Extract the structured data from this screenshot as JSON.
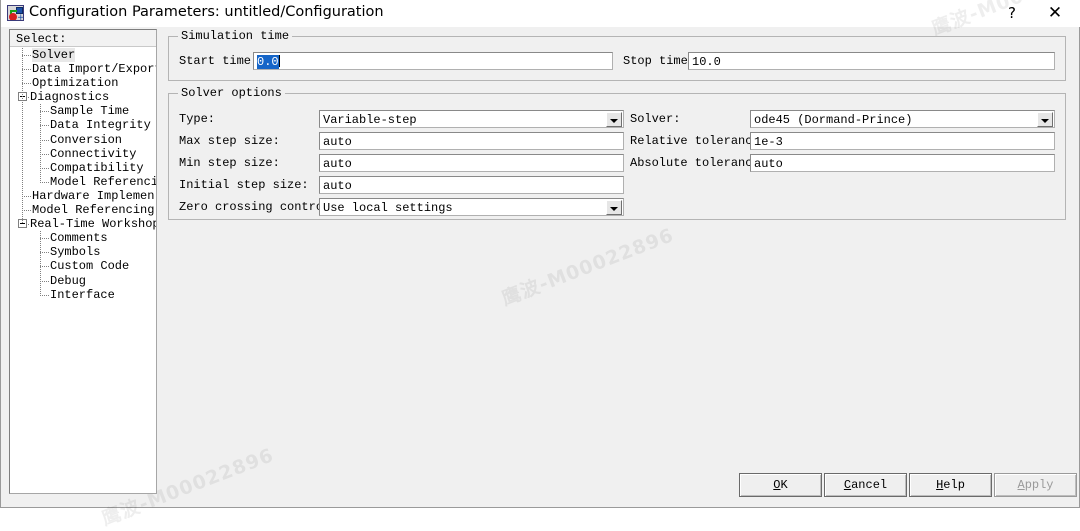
{
  "window": {
    "title": "Configuration Parameters: untitled/Configuration",
    "icon": "simulink-icon",
    "help_button": "?",
    "close_button": "✕"
  },
  "tree": {
    "header": "Select:",
    "nodes": [
      {
        "label": "Solver",
        "depth": 1,
        "selected": true,
        "expander": false
      },
      {
        "label": "Data Import/Export",
        "depth": 1,
        "selected": false,
        "expander": false
      },
      {
        "label": "Optimization",
        "depth": 1,
        "selected": false,
        "expander": false
      },
      {
        "label": "Diagnostics",
        "depth": 0,
        "selected": false,
        "expander": true
      },
      {
        "label": "Sample Time",
        "depth": 2,
        "selected": false,
        "expander": false
      },
      {
        "label": "Data Integrity",
        "depth": 2,
        "selected": false,
        "expander": false
      },
      {
        "label": "Conversion",
        "depth": 2,
        "selected": false,
        "expander": false
      },
      {
        "label": "Connectivity",
        "depth": 2,
        "selected": false,
        "expander": false
      },
      {
        "label": "Compatibility",
        "depth": 2,
        "selected": false,
        "expander": false
      },
      {
        "label": "Model Referencing",
        "depth": 2,
        "selected": false,
        "expander": false
      },
      {
        "label": "Hardware Implemen...",
        "depth": 1,
        "selected": false,
        "expander": false
      },
      {
        "label": "Model Referencing",
        "depth": 1,
        "selected": false,
        "expander": false
      },
      {
        "label": "Real-Time Workshop",
        "depth": 0,
        "selected": false,
        "expander": true
      },
      {
        "label": "Comments",
        "depth": 2,
        "selected": false,
        "expander": false
      },
      {
        "label": "Symbols",
        "depth": 2,
        "selected": false,
        "expander": false
      },
      {
        "label": "Custom Code",
        "depth": 2,
        "selected": false,
        "expander": false
      },
      {
        "label": "Debug",
        "depth": 2,
        "selected": false,
        "expander": false
      },
      {
        "label": "Interface",
        "depth": 2,
        "selected": false,
        "expander": false
      }
    ]
  },
  "simulation_time": {
    "group_title": "Simulation time",
    "start_label": "Start time:",
    "start_value": "0.0",
    "stop_label": "Stop time:",
    "stop_value": "10.0"
  },
  "solver_options": {
    "group_title": "Solver options",
    "type_label": "Type:",
    "type_value": "Variable-step",
    "max_step_label": "Max step size:",
    "max_step_value": "auto",
    "min_step_label": "Min step size:",
    "min_step_value": "auto",
    "initial_step_label": "Initial step size:",
    "initial_step_value": "auto",
    "zero_cross_label": "Zero crossing control:",
    "zero_cross_value": "Use local settings",
    "solver_label": "Solver:",
    "solver_value": "ode45 (Dormand-Prince)",
    "rel_tol_label": "Relative tolerance:",
    "rel_tol_value": "1e-3",
    "abs_tol_label": "Absolute tolerance:",
    "abs_tol_value": "auto"
  },
  "buttons": {
    "ok": {
      "pre": "",
      "mn": "O",
      "post": "K"
    },
    "cancel": {
      "pre": "",
      "mn": "C",
      "post": "ancel"
    },
    "help": {
      "pre": "",
      "mn": "H",
      "post": "elp"
    },
    "apply": {
      "pre": "",
      "mn": "A",
      "post": "pply",
      "disabled": true
    }
  },
  "watermark": {
    "text": "鹰波-M00022896"
  },
  "colors": {
    "dialog_face": "#f0f0f0",
    "field_bg": "#ffffff",
    "selection_blue": "#1565c8",
    "tree_selection": "#e8e8e8",
    "border": "#b4b4b4"
  }
}
